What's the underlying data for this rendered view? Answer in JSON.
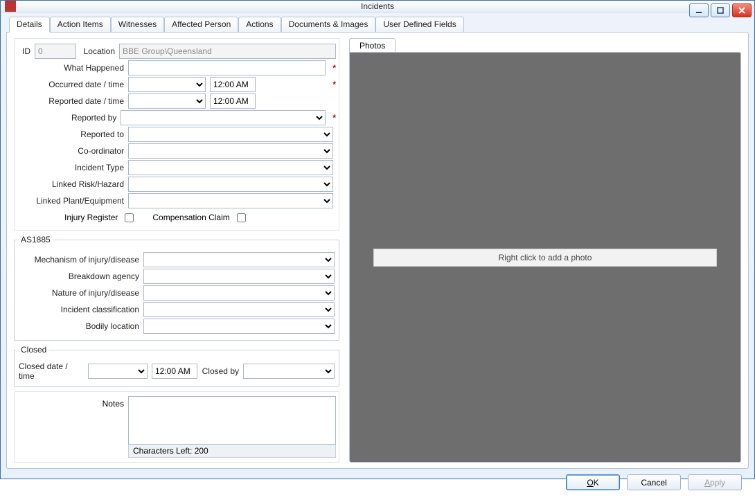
{
  "window": {
    "title": "Incidents"
  },
  "tabs": [
    "Details",
    "Action Items",
    "Witnesses",
    "Affected Person",
    "Actions",
    "Documents & Images",
    "User Defined Fields"
  ],
  "tabs_active": 0,
  "form": {
    "id_label": "ID",
    "id_value": "0",
    "location_label": "Location",
    "location_value": "BBE Group\\Queensland",
    "what_happened_label": "What Happened",
    "what_happened_value": "",
    "occurred_label": "Occurred date / time",
    "occurred_date": "",
    "occurred_time": "12:00 AM",
    "reported_date_label": "Reported date / time",
    "reported_date": "",
    "reported_time": "12:00 AM",
    "reported_by_label": "Reported by",
    "reported_by_value": "",
    "reported_to_label": "Reported to",
    "reported_to_value": "",
    "coordinator_label": "Co-ordinator",
    "coordinator_value": "",
    "incident_type_label": "Incident Type",
    "incident_type_value": "",
    "linked_risk_label": "Linked Risk/Hazard",
    "linked_risk_value": "",
    "linked_plant_label": "Linked Plant/Equipment",
    "linked_plant_value": "",
    "injury_register_label": "Injury Register",
    "compensation_label": "Compensation Claim"
  },
  "as1885": {
    "legend": "AS1885",
    "mechanism_label": "Mechanism of injury/disease",
    "mechanism_value": "",
    "breakdown_label": "Breakdown agency",
    "breakdown_value": "",
    "nature_label": "Nature of injury/disease",
    "nature_value": "",
    "classification_label": "Incident classification",
    "classification_value": "",
    "bodily_label": "Bodily location",
    "bodily_value": ""
  },
  "closed": {
    "legend": "Closed",
    "date_label": "Closed date / time",
    "date_value": "",
    "time_value": "12:00 AM",
    "by_label": "Closed by",
    "by_value": ""
  },
  "notes": {
    "label": "Notes",
    "value": "",
    "char_left": "Characters Left: 200"
  },
  "photos": {
    "tab_label": "Photos",
    "hint": "Right click to add a photo"
  },
  "buttons": {
    "ok": "OK",
    "cancel": "Cancel",
    "apply": "Apply"
  }
}
